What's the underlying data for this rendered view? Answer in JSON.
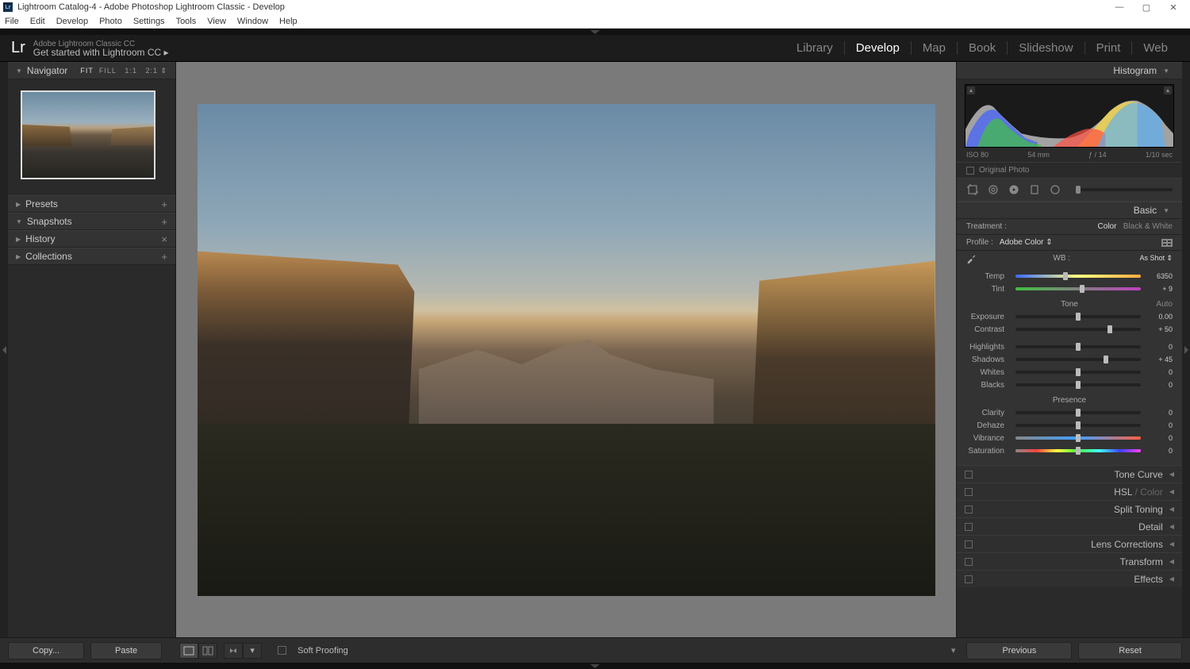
{
  "titlebar": {
    "title": "Lightroom Catalog-4 - Adobe Photoshop Lightroom Classic - Develop"
  },
  "menubar": [
    "File",
    "Edit",
    "Develop",
    "Photo",
    "Settings",
    "Tools",
    "View",
    "Window",
    "Help"
  ],
  "identity": {
    "brand_small": "Adobe Lightroom Classic CC",
    "brand_large": "Get started with Lightroom CC  ▸"
  },
  "modules": [
    {
      "label": "Library",
      "active": false
    },
    {
      "label": "Develop",
      "active": true
    },
    {
      "label": "Map",
      "active": false
    },
    {
      "label": "Book",
      "active": false
    },
    {
      "label": "Slideshow",
      "active": false
    },
    {
      "label": "Print",
      "active": false
    },
    {
      "label": "Web",
      "active": false
    }
  ],
  "left_panels": {
    "navigator": {
      "title": "Navigator",
      "zoom": "FIT  FILL   1:1   2:1  ⇕",
      "fit": "FIT"
    },
    "items": [
      {
        "title": "Presets",
        "action": "+"
      },
      {
        "title": "Snapshots",
        "action": "+"
      },
      {
        "title": "History",
        "action": "×"
      },
      {
        "title": "Collections",
        "action": "+"
      }
    ]
  },
  "right": {
    "histogram": {
      "title": "Histogram",
      "meta": {
        "iso": "ISO 80",
        "focal": "54 mm",
        "aperture": "ƒ / 14",
        "shutter": "1/10 sec"
      },
      "original": "Original Photo"
    },
    "basic": {
      "title": "Basic",
      "treatment_label": "Treatment :",
      "treatment_color": "Color",
      "treatment_bw": "Black & White",
      "profile_label": "Profile :",
      "profile_value": "Adobe Color  ⇕",
      "wb_label": "WB :",
      "wb_value": "As Shot ⇕",
      "temp": {
        "label": "Temp",
        "value": "6350",
        "pos": 40
      },
      "tint": {
        "label": "Tint",
        "value": "+ 9",
        "pos": 53
      },
      "tone_label": "Tone",
      "auto": "Auto",
      "exposure": {
        "label": "Exposure",
        "value": "0.00",
        "pos": 50
      },
      "contrast": {
        "label": "Contrast",
        "value": "+ 50",
        "pos": 75
      },
      "highlights": {
        "label": "Highlights",
        "value": "0",
        "pos": 50
      },
      "shadows": {
        "label": "Shadows",
        "value": "+ 45",
        "pos": 72
      },
      "whites": {
        "label": "Whites",
        "value": "0",
        "pos": 50
      },
      "blacks": {
        "label": "Blacks",
        "value": "0",
        "pos": 50
      },
      "presence_label": "Presence",
      "clarity": {
        "label": "Clarity",
        "value": "0",
        "pos": 50
      },
      "dehaze": {
        "label": "Dehaze",
        "value": "0",
        "pos": 50
      },
      "vibrance": {
        "label": "Vibrance",
        "value": "0",
        "pos": 50
      },
      "saturation": {
        "label": "Saturation",
        "value": "0",
        "pos": 50
      }
    },
    "collapsed": [
      {
        "name": "Tone Curve"
      },
      {
        "name": "HSL",
        "dim": " / Color"
      },
      {
        "name": "Split Toning"
      },
      {
        "name": "Detail"
      },
      {
        "name": "Lens Corrections"
      },
      {
        "name": "Transform"
      },
      {
        "name": "Effects"
      }
    ]
  },
  "bottom": {
    "copy": "Copy...",
    "paste": "Paste",
    "soft_proof": "Soft Proofing",
    "previous": "Previous",
    "reset": "Reset"
  }
}
